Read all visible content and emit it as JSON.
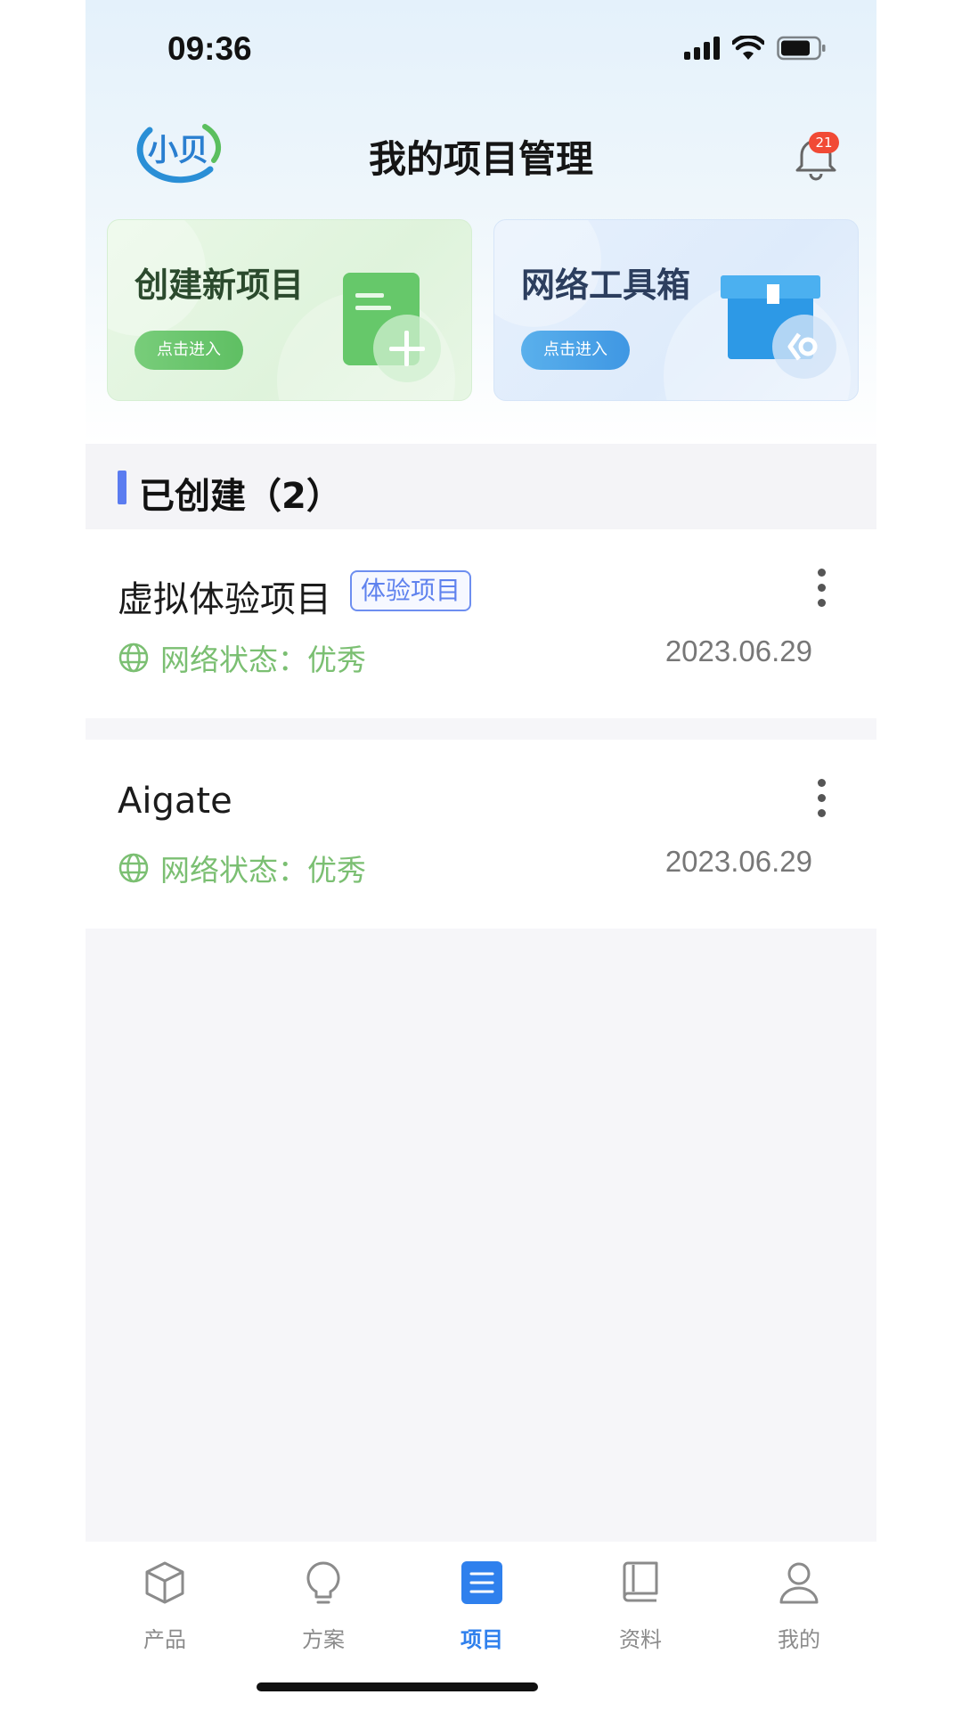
{
  "status_bar": {
    "time": "09:36"
  },
  "header": {
    "logo_text": "小贝",
    "title": "我的项目管理",
    "notification_count": "21"
  },
  "cards": [
    {
      "title": "创建新项目",
      "button": "点击进入",
      "icon": "document-plus-icon",
      "accent": "#5fbf63"
    },
    {
      "title": "网络工具箱",
      "button": "点击进入",
      "icon": "toolbox-icon",
      "accent": "#3f97e3"
    }
  ],
  "section": {
    "title": "已创建（2）"
  },
  "projects": [
    {
      "name": "虚拟体验项目",
      "tag": "体验项目",
      "status": "网络状态：优秀",
      "date": "2023.06.29"
    },
    {
      "name": "Aigate",
      "tag": "",
      "status": "网络状态：优秀",
      "date": "2023.06.29"
    }
  ],
  "tabbar": {
    "active": "项目",
    "items": [
      {
        "label": "产品",
        "icon": "cube-icon"
      },
      {
        "label": "方案",
        "icon": "lightbulb-icon"
      },
      {
        "label": "项目",
        "icon": "list-icon"
      },
      {
        "label": "资料",
        "icon": "book-icon"
      },
      {
        "label": "我的",
        "icon": "user-icon"
      }
    ]
  },
  "colors": {
    "primary": "#2f80ed",
    "status_good": "#7bbf72",
    "section_bar": "#5b7cf0",
    "badge": "#f14a35"
  }
}
